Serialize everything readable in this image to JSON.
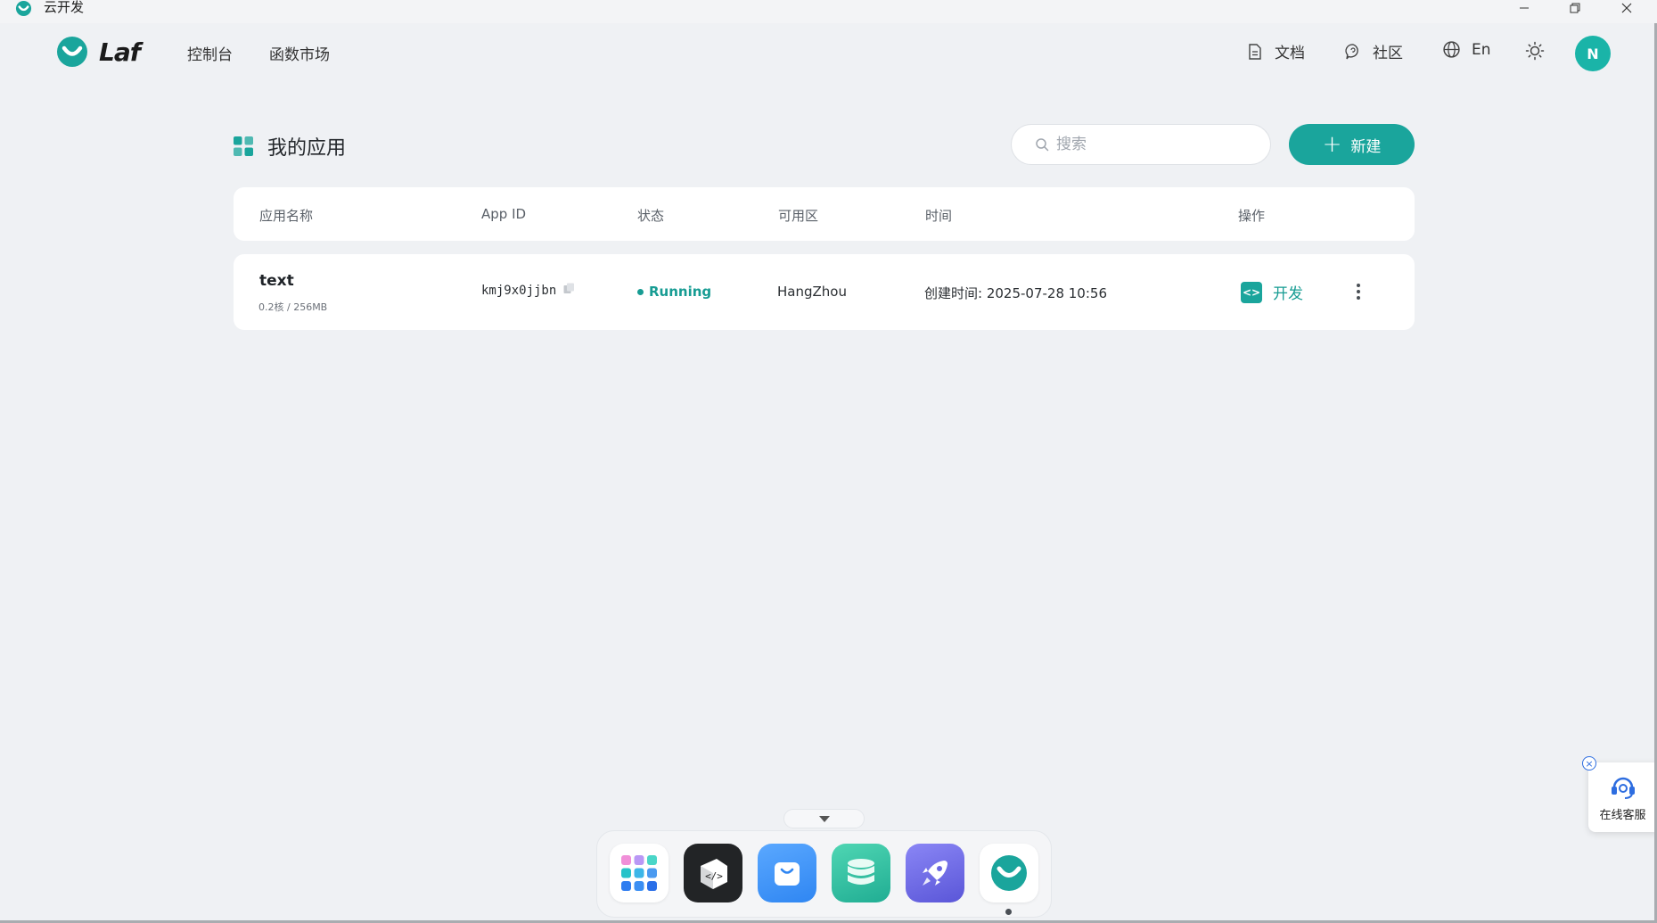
{
  "window": {
    "title": "云开发"
  },
  "header": {
    "brand": "Laf",
    "nav": [
      "控制台",
      "函数市场"
    ],
    "docs_label": "文档",
    "community_label": "社区",
    "language_label": "En",
    "avatar_initial": "N"
  },
  "main": {
    "title": "我的应用",
    "search_placeholder": "搜索",
    "new_button_label": "新建",
    "table": {
      "columns": [
        "应用名称",
        "App ID",
        "状态",
        "可用区",
        "时间",
        "操作"
      ],
      "rows": [
        {
          "name": "text",
          "spec": "0.2核 / 256MB",
          "app_id": "kmj9x0jjbn",
          "status": "Running",
          "region": "HangZhou",
          "created": "创建时间: 2025-07-28 10:56",
          "action_label": "开发"
        }
      ]
    }
  },
  "dock": {
    "apps": [
      "app-launcher-icon",
      "code-editor-icon",
      "store-bag-icon",
      "database-icon",
      "rocket-icon",
      "laf-icon"
    ]
  },
  "service_widget": {
    "label": "在线客服"
  },
  "colors": {
    "accent": "#1aa59c",
    "background": "#eff1f4"
  }
}
